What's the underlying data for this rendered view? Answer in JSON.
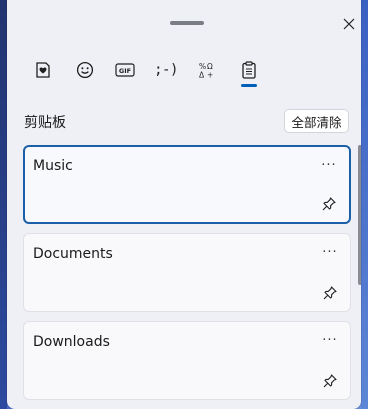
{
  "window": {
    "close_icon": "close-icon"
  },
  "tabs": [
    {
      "name": "kaomoji-favorites",
      "icon": "heart-note-icon"
    },
    {
      "name": "emoji",
      "icon": "emoji-icon"
    },
    {
      "name": "gif",
      "label": "GIF",
      "icon": "gif-icon"
    },
    {
      "name": "kaomoji",
      "label": ";-)",
      "icon": "kaomoji-icon"
    },
    {
      "name": "symbols",
      "icon": "symbols-icon"
    },
    {
      "name": "clipboard",
      "icon": "clipboard-icon",
      "active": true
    }
  ],
  "clipboard": {
    "title": "剪贴板",
    "clear_all_label": "全部清除",
    "items": [
      {
        "text": "Music",
        "selected": true
      },
      {
        "text": "Documents",
        "selected": false
      },
      {
        "text": "Downloads",
        "selected": false
      }
    ],
    "more_label": "···"
  },
  "colors": {
    "accent": "#005fb8",
    "panel_bg": "#eef0f6"
  }
}
